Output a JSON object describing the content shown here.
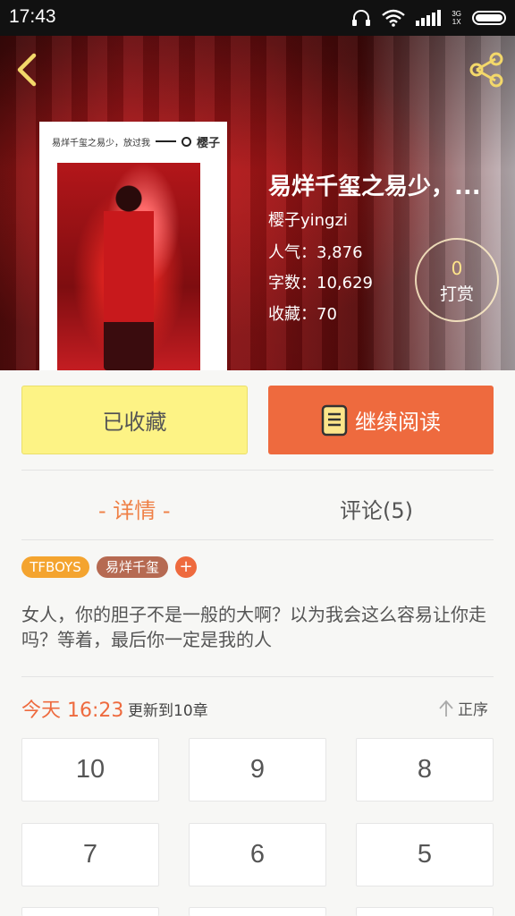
{
  "status_bar": {
    "time": "17:43",
    "network": "3G\n1X"
  },
  "book": {
    "title": "易烊千玺之易少，...",
    "author": "樱子yingzi",
    "popularity": "人气：3,876",
    "words": "字数：10,629",
    "favorites": "收藏：70",
    "cover_text": "易烊千玺之易少，放过我",
    "cover_author": "樱子"
  },
  "tip": {
    "count": "0",
    "label": "打赏"
  },
  "actions": {
    "collected": "已收藏",
    "continue": "继续阅读"
  },
  "tabs": {
    "details": "- 详情 -",
    "comments": "评论(5)"
  },
  "tags": [
    "TFBOYS",
    "易烊千玺"
  ],
  "tag_add": "+",
  "synopsis": "女人，你的胆子不是一般的大啊？以为我会这么容易让你走吗？等着，最后你一定是我的人",
  "update": {
    "time": "今天 16:23",
    "text": "更新到10章",
    "order": "正序"
  },
  "chapters": [
    "10",
    "9",
    "8",
    "7",
    "6",
    "5"
  ],
  "colors": {
    "accent": "#ee6a3e",
    "collected_bg": "#fdf385",
    "tag1": "#f4a42f",
    "tag2": "#b66a52"
  },
  "icons": {
    "back": "chevron-left-icon",
    "share": "share-icon",
    "book": "book-icon",
    "order": "arrow-up-icon"
  }
}
